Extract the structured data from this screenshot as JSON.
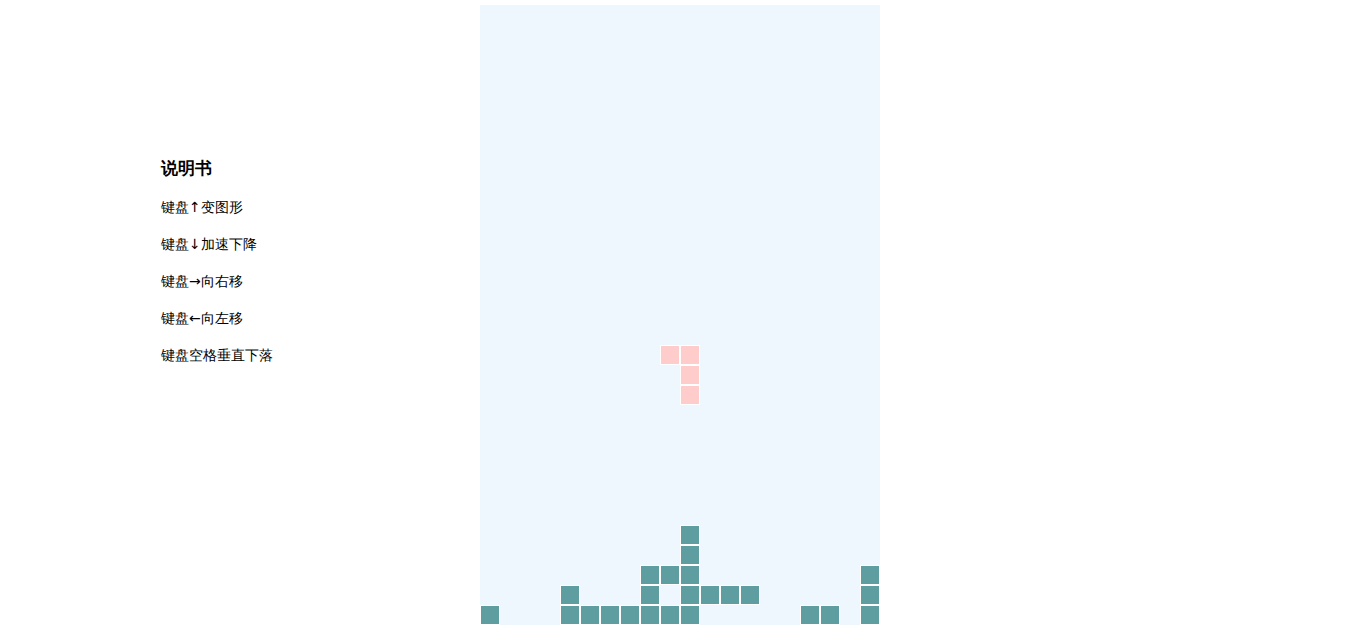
{
  "manual": {
    "title": "说明书",
    "items": [
      "键盘↑变图形",
      "键盘↓加速下降",
      "键盘→向右移",
      "键盘←向左移",
      "键盘空格垂直下落"
    ]
  },
  "board": {
    "columns": 20,
    "rows": 31,
    "cells": [
      {
        "row": 17,
        "col": 9,
        "kind": "active"
      },
      {
        "row": 17,
        "col": 10,
        "kind": "active"
      },
      {
        "row": 18,
        "col": 10,
        "kind": "active"
      },
      {
        "row": 19,
        "col": 10,
        "kind": "active"
      },
      {
        "row": 26,
        "col": 10,
        "kind": "locked"
      },
      {
        "row": 27,
        "col": 10,
        "kind": "locked"
      },
      {
        "row": 28,
        "col": 8,
        "kind": "locked"
      },
      {
        "row": 28,
        "col": 9,
        "kind": "locked"
      },
      {
        "row": 28,
        "col": 10,
        "kind": "locked"
      },
      {
        "row": 28,
        "col": 19,
        "kind": "locked"
      },
      {
        "row": 29,
        "col": 4,
        "kind": "locked"
      },
      {
        "row": 29,
        "col": 8,
        "kind": "locked"
      },
      {
        "row": 29,
        "col": 10,
        "kind": "locked"
      },
      {
        "row": 29,
        "col": 11,
        "kind": "locked"
      },
      {
        "row": 29,
        "col": 12,
        "kind": "locked"
      },
      {
        "row": 29,
        "col": 13,
        "kind": "locked"
      },
      {
        "row": 29,
        "col": 19,
        "kind": "locked"
      },
      {
        "row": 30,
        "col": 0,
        "kind": "locked"
      },
      {
        "row": 30,
        "col": 4,
        "kind": "locked"
      },
      {
        "row": 30,
        "col": 5,
        "kind": "locked"
      },
      {
        "row": 30,
        "col": 6,
        "kind": "locked"
      },
      {
        "row": 30,
        "col": 7,
        "kind": "locked"
      },
      {
        "row": 30,
        "col": 8,
        "kind": "locked"
      },
      {
        "row": 30,
        "col": 9,
        "kind": "locked"
      },
      {
        "row": 30,
        "col": 10,
        "kind": "locked"
      },
      {
        "row": 30,
        "col": 16,
        "kind": "locked"
      },
      {
        "row": 30,
        "col": 17,
        "kind": "locked"
      },
      {
        "row": 30,
        "col": 19,
        "kind": "locked"
      }
    ]
  }
}
